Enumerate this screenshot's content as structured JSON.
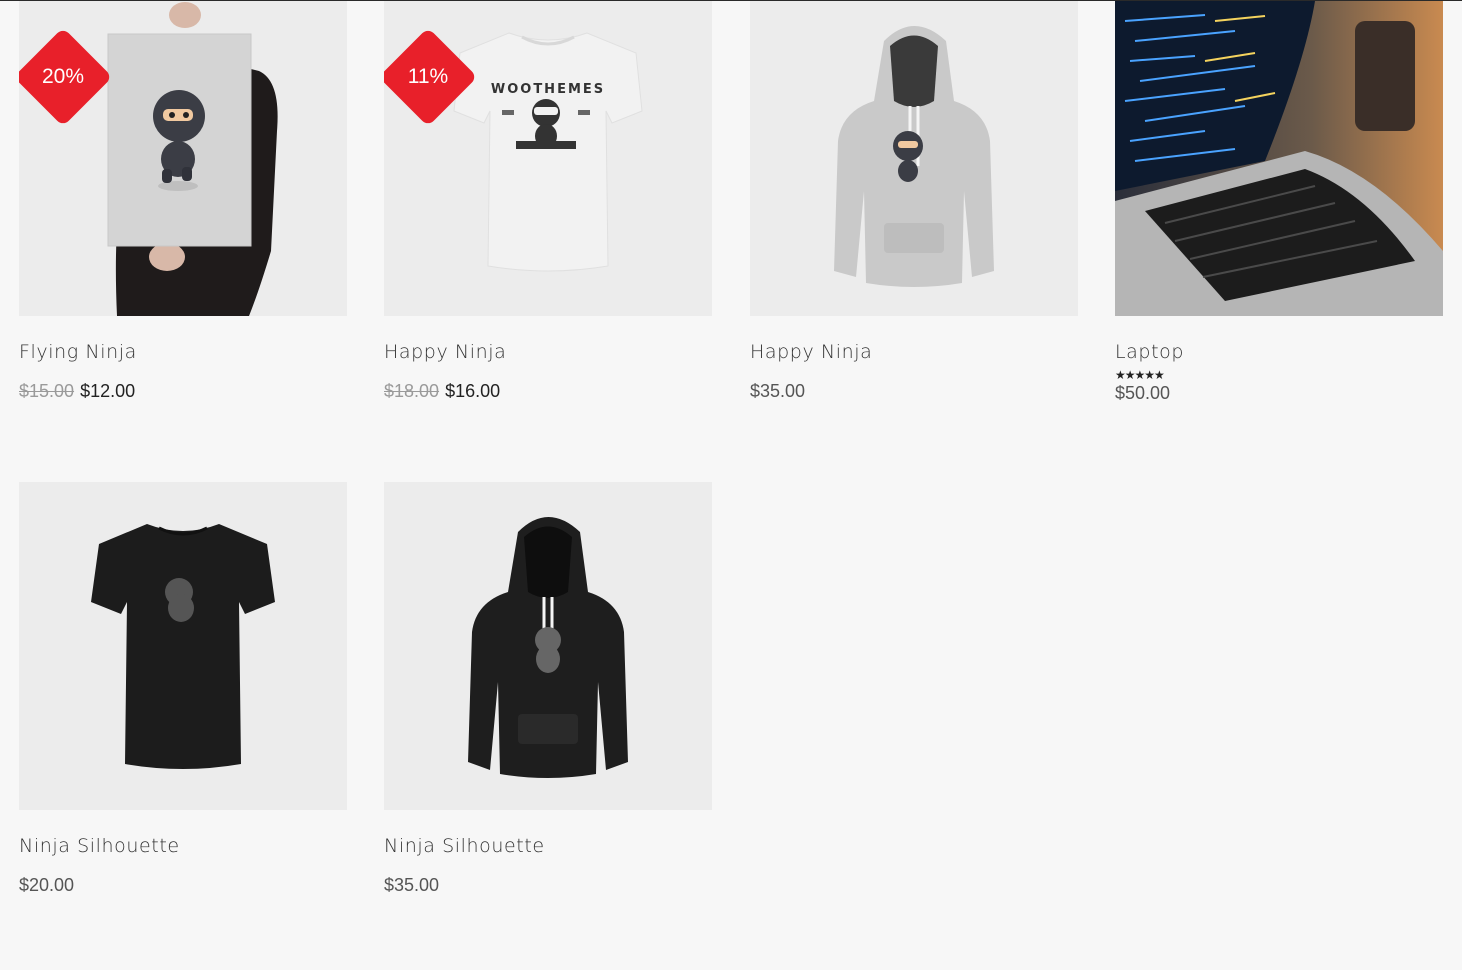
{
  "products": [
    {
      "title": "Flying Ninja",
      "badge": "20%",
      "old_price": "$15.00",
      "price": "$12.00",
      "image": "poster-ninja-image"
    },
    {
      "title": "Happy Ninja",
      "badge": "11%",
      "old_price": "$18.00",
      "price": "$16.00",
      "image": "tshirt-white-ninja-image"
    },
    {
      "title": "Happy Ninja",
      "price": "$35.00",
      "image": "hoodie-grey-ninja-image"
    },
    {
      "title": "Laptop",
      "rating": "★★★★★",
      "rating_value": 5,
      "price": "$50.00",
      "image": "laptop-code-image"
    },
    {
      "title": "Ninja Silhouette",
      "price": "$20.00",
      "image": "tshirt-black-silhouette-image"
    },
    {
      "title": "Ninja Silhouette",
      "price": "$35.00",
      "image": "hoodie-black-silhouette-image"
    }
  ],
  "colors": {
    "sale_badge": "#e8202a",
    "background": "#f7f7f7"
  }
}
